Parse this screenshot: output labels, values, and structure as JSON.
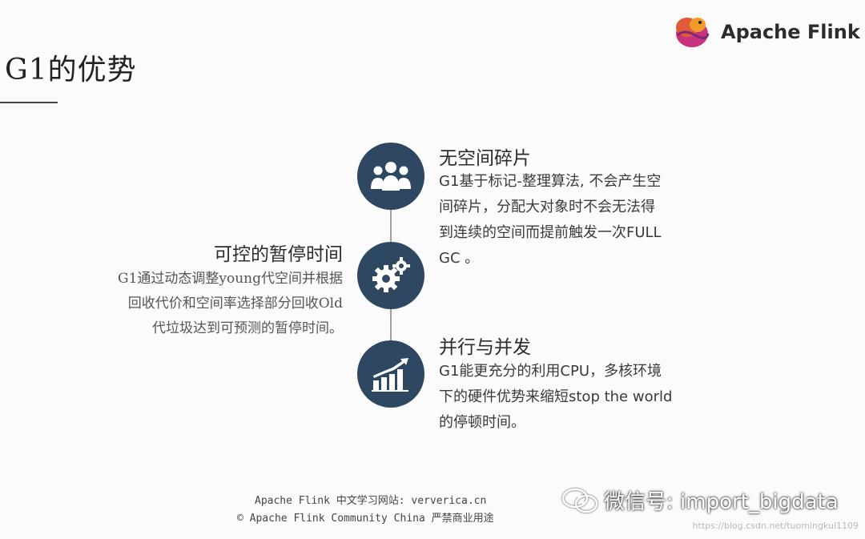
{
  "slide": {
    "title": "G1的优势"
  },
  "logo": {
    "text": "Apache Flink"
  },
  "icons": {
    "top": "people-group-icon",
    "middle": "gears-icon",
    "bottom": "growth-chart-icon"
  },
  "colors": {
    "circle": "#2e4862",
    "line": "#9aa3ad"
  },
  "blocks": {
    "no_fragment": {
      "heading": "无空间碎片",
      "lines": [
        "G1基于标记-整理算法, 不会产生空",
        "间碎片，分配大对象时不会无法得",
        "到连续的空间而提前触发一次FULL",
        "GC 。"
      ]
    },
    "pause": {
      "heading": "可控的暂停时间",
      "lines": [
        "G1通过动态调整young代空间并根据",
        "回收代价和空间率选择部分回收Old",
        "代垃圾达到可预测的暂停时间。"
      ]
    },
    "parallel": {
      "heading": "并行与并发",
      "lines": [
        "G1能更充分的利用CPU，多核环境",
        "下的硬件优势来缩短stop the world",
        "的停顿时间。"
      ]
    }
  },
  "footer": {
    "line1": "Apache Flink 中文学习网站: ververica.cn",
    "line2": "© Apache Flink Community China  严禁商业用途"
  },
  "wechat": {
    "label": "微信号: import_bigdata"
  },
  "watermark": {
    "text": "https://blog.csdn.net/tuomingkui1109"
  }
}
